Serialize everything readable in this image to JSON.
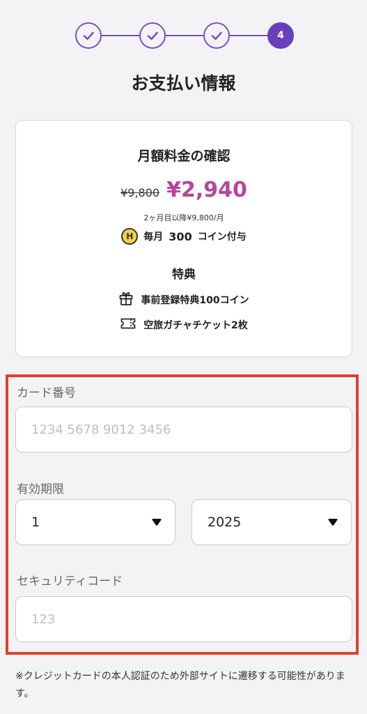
{
  "stepper": {
    "steps": [
      {
        "state": "done",
        "label": ""
      },
      {
        "state": "done",
        "label": ""
      },
      {
        "state": "done",
        "label": ""
      },
      {
        "state": "current",
        "label": "4"
      }
    ],
    "accent_color": "#6a3fba"
  },
  "page_title": "お支払い情報",
  "plan": {
    "title": "月額料金の確認",
    "old_price": "¥9,800",
    "new_price": "¥2,940",
    "price_color": "#b4479c",
    "price_note": "2ヶ月目以降¥9,800/月",
    "coin": {
      "badge": "H",
      "prefix": "毎月",
      "amount": "300",
      "suffix": "コイン付与"
    },
    "perks_title": "特典",
    "perks": [
      {
        "icon": "gift-icon",
        "label": "事前登録特典100コイン"
      },
      {
        "icon": "ticket-icon",
        "label": "空旅ガチャチケット2枚"
      }
    ]
  },
  "form": {
    "card_number": {
      "label": "カード番号",
      "placeholder": "1234 5678 9012 3456",
      "value": ""
    },
    "expiry": {
      "label": "有効期限",
      "month": "1",
      "year": "2025"
    },
    "security_code": {
      "label": "セキュリティコード",
      "placeholder": "123",
      "value": ""
    },
    "highlight_color": "#e0402f"
  },
  "note": "※クレジットカードの本人認証のため外部サイトに遷移する可能性があります。"
}
